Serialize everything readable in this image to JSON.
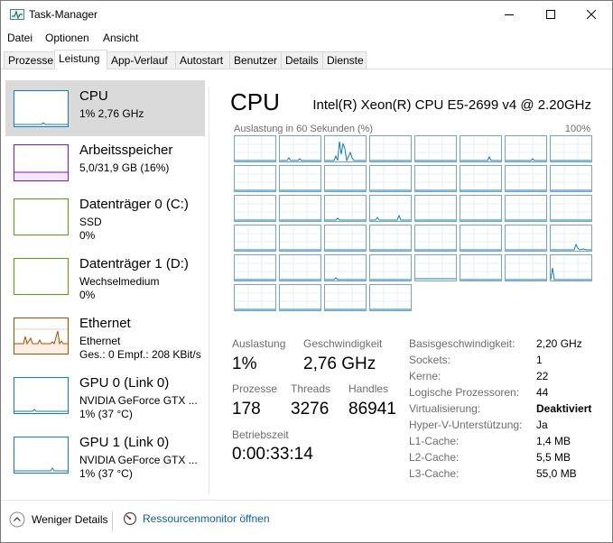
{
  "window": {
    "title": "Task-Manager"
  },
  "menu": [
    "Datei",
    "Optionen",
    "Ansicht"
  ],
  "tabs": [
    "Prozesse",
    "Leistung",
    "App-Verlauf",
    "Autostart",
    "Benutzer",
    "Details",
    "Dienste"
  ],
  "active_tab": "Leistung",
  "sidebar": {
    "items": [
      {
        "name": "CPU",
        "line1": "1% 2,76 GHz",
        "line2": "",
        "color": "#117dbb",
        "selected": true
      },
      {
        "name": "Arbeitsspeicher",
        "line1": "5,0/31,9 GB (16%)",
        "line2": "",
        "color": "#8b12ae",
        "selected": false
      },
      {
        "name": "Datenträger 0 (C:)",
        "line1": "SSD",
        "line2": "0%",
        "color": "#4da60c",
        "selected": false
      },
      {
        "name": "Datenträger 1 (D:)",
        "line1": "Wechselmedium",
        "line2": "0%",
        "color": "#4da60c",
        "selected": false
      },
      {
        "name": "Ethernet",
        "line1": "Ethernet",
        "line2": "Ges.: 0  Empf.: 208 KBit/s",
        "color": "#a74f01",
        "selected": false
      },
      {
        "name": "GPU 0 (Link 0)",
        "line1": "NVIDIA GeForce GTX ...",
        "line2": "1%  (37 °C)",
        "color": "#117dbb",
        "selected": false
      },
      {
        "name": "GPU 1 (Link 0)",
        "line1": "NVIDIA GeForce GTX ...",
        "line2": "1%  (37 °C)",
        "color": "#117dbb",
        "selected": false
      }
    ]
  },
  "main": {
    "heading": "CPU",
    "model": "Intel(R) Xeon(R) CPU E5-2699 v4 @ 2.20GHz",
    "graph_label": "Auslastung in 60 Sekunden (%)",
    "graph_max": "100%",
    "core_count": 44,
    "stats": {
      "auslastung_label": "Auslastung",
      "auslastung": "1%",
      "geschwindigkeit_label": "Geschwindigkeit",
      "geschwindigkeit": "2,76 GHz",
      "prozesse_label": "Prozesse",
      "prozesse": "178",
      "threads_label": "Threads",
      "threads": "3276",
      "handles_label": "Handles",
      "handles": "86941",
      "betriebszeit_label": "Betriebszeit",
      "betriebszeit": "0:00:33:14"
    },
    "info": [
      {
        "label": "Basisgeschwindigkeit:",
        "value": "2,20 GHz"
      },
      {
        "label": "Sockets:",
        "value": "1"
      },
      {
        "label": "Kerne:",
        "value": "22"
      },
      {
        "label": "Logische Prozessoren:",
        "value": "44"
      },
      {
        "label": "Virtualisierung:",
        "value": "Deaktiviert"
      },
      {
        "label": "Hyper-V-Unterstützung:",
        "value": "Ja"
      },
      {
        "label": "L1-Cache:",
        "value": "1,4 MB"
      },
      {
        "label": "L2-Cache:",
        "value": "5,5 MB"
      },
      {
        "label": "L3-Cache:",
        "value": "55,0 MB"
      }
    ]
  },
  "footer": {
    "fewer_details": "Weniger Details",
    "resource_monitor": "Ressourcenmonitor öffnen"
  },
  "colors": {
    "cpu_line": "#117dbb",
    "cpu_border": "#75a5c6",
    "selected_bg": "#dadada"
  }
}
